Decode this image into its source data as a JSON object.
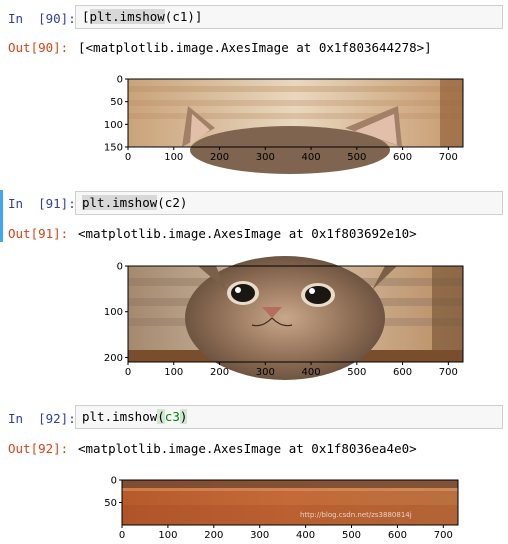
{
  "cells": [
    {
      "in_label": "In  [90]:",
      "code_pre": "[",
      "code_fn": "plt.imshow",
      "code_mid": "(c1)",
      "code_post": "]",
      "out_label": "Out[90]:",
      "out_text": "[<matplotlib.image.AxesImage at 0x1f803644278>]",
      "xticks": [
        "0",
        "100",
        "200",
        "300",
        "400",
        "500",
        "600",
        "700"
      ],
      "yticks": [
        "0",
        "50",
        "100",
        "150"
      ]
    },
    {
      "in_label": "In  [91]:",
      "code_fn": "plt.imshow",
      "code_mid": "(c2)",
      "out_label": "Out[91]:",
      "out_text": "<matplotlib.image.AxesImage at 0x1f803692e10>",
      "xticks": [
        "0",
        "100",
        "200",
        "300",
        "400",
        "500",
        "600",
        "700"
      ],
      "yticks": [
        "0",
        "100",
        "200"
      ]
    },
    {
      "in_label": "In  [92]:",
      "code_fn": "plt.imshow",
      "code_open": "(",
      "code_arg": "c3",
      "code_close": ")",
      "out_label": "Out[92]:",
      "out_text": "<matplotlib.image.AxesImage at 0x1f8036ea4e0>",
      "xticks": [
        "0",
        "100",
        "200",
        "300",
        "400",
        "500",
        "600",
        "700"
      ],
      "yticks": [
        "0",
        "50"
      ],
      "watermark": "http://blog.csdn.net/zs3880814j"
    }
  ],
  "image_subject": "cat peeking over edge",
  "colors": {
    "prompt": "#303f9f",
    "out": "#d84315",
    "cell_bg": "#f7f7f7",
    "cell_border": "#cfcfcf",
    "active_bar": "#42a5f5"
  }
}
